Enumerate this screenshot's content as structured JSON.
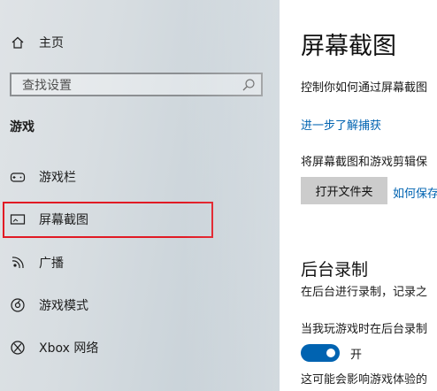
{
  "sidebar": {
    "home_label": "主页",
    "search_placeholder": "查找设置",
    "section_title": "游戏",
    "items": [
      {
        "label": "游戏栏",
        "icon": "game-bar-icon"
      },
      {
        "label": "屏幕截图",
        "icon": "captures-icon"
      },
      {
        "label": "广播",
        "icon": "broadcast-icon"
      },
      {
        "label": "游戏模式",
        "icon": "game-mode-icon"
      },
      {
        "label": "Xbox 网络",
        "icon": "xbox-icon"
      }
    ],
    "highlight_color": "#e11a24"
  },
  "main": {
    "title": "屏幕截图",
    "description": "控制你如何通过屏幕截图",
    "learn_more_link": "进一步了解捕获",
    "save_location_text": "将屏幕截图和游戏剪辑保",
    "open_folder_button": "打开文件夹",
    "how_to_link": "如何保存",
    "background_recording": {
      "title": "后台录制",
      "description": "在后台进行录制，记录之",
      "toggle_label": "当我玩游戏时在后台录制",
      "toggle_state": "开",
      "toggle_on": true,
      "note": "这可能会影响游戏体验的"
    }
  },
  "colors": {
    "accent": "#0063b1",
    "button_bg": "#cccccc"
  }
}
